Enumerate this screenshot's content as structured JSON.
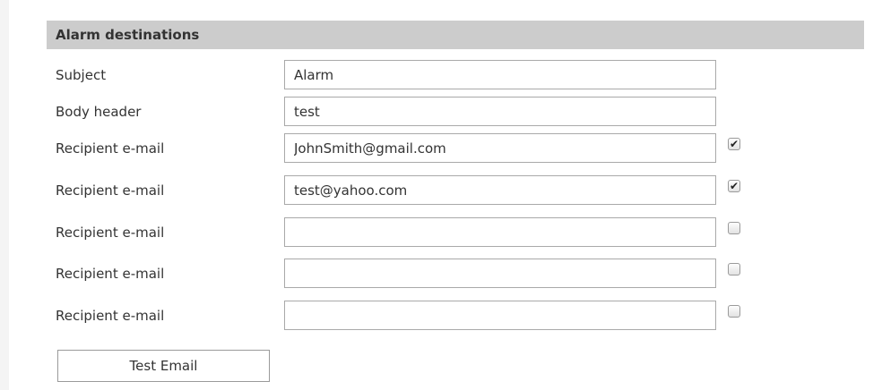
{
  "section": {
    "title": "Alarm destinations"
  },
  "fields": {
    "subject": {
      "label": "Subject",
      "value": "Alarm"
    },
    "body_header": {
      "label": "Body header",
      "value": "test"
    }
  },
  "recipients": [
    {
      "label": "Recipient e-mail",
      "value": "JohnSmith@gmail.com",
      "checked": true
    },
    {
      "label": "Recipient e-mail",
      "value": "test@yahoo.com",
      "checked": true
    },
    {
      "label": "Recipient e-mail",
      "value": "",
      "checked": false
    },
    {
      "label": "Recipient e-mail",
      "value": "",
      "checked": false
    },
    {
      "label": "Recipient e-mail",
      "value": "",
      "checked": false
    }
  ],
  "actions": {
    "test_email_label": "Test Email"
  },
  "icons": {
    "check_mark": "check-icon"
  }
}
